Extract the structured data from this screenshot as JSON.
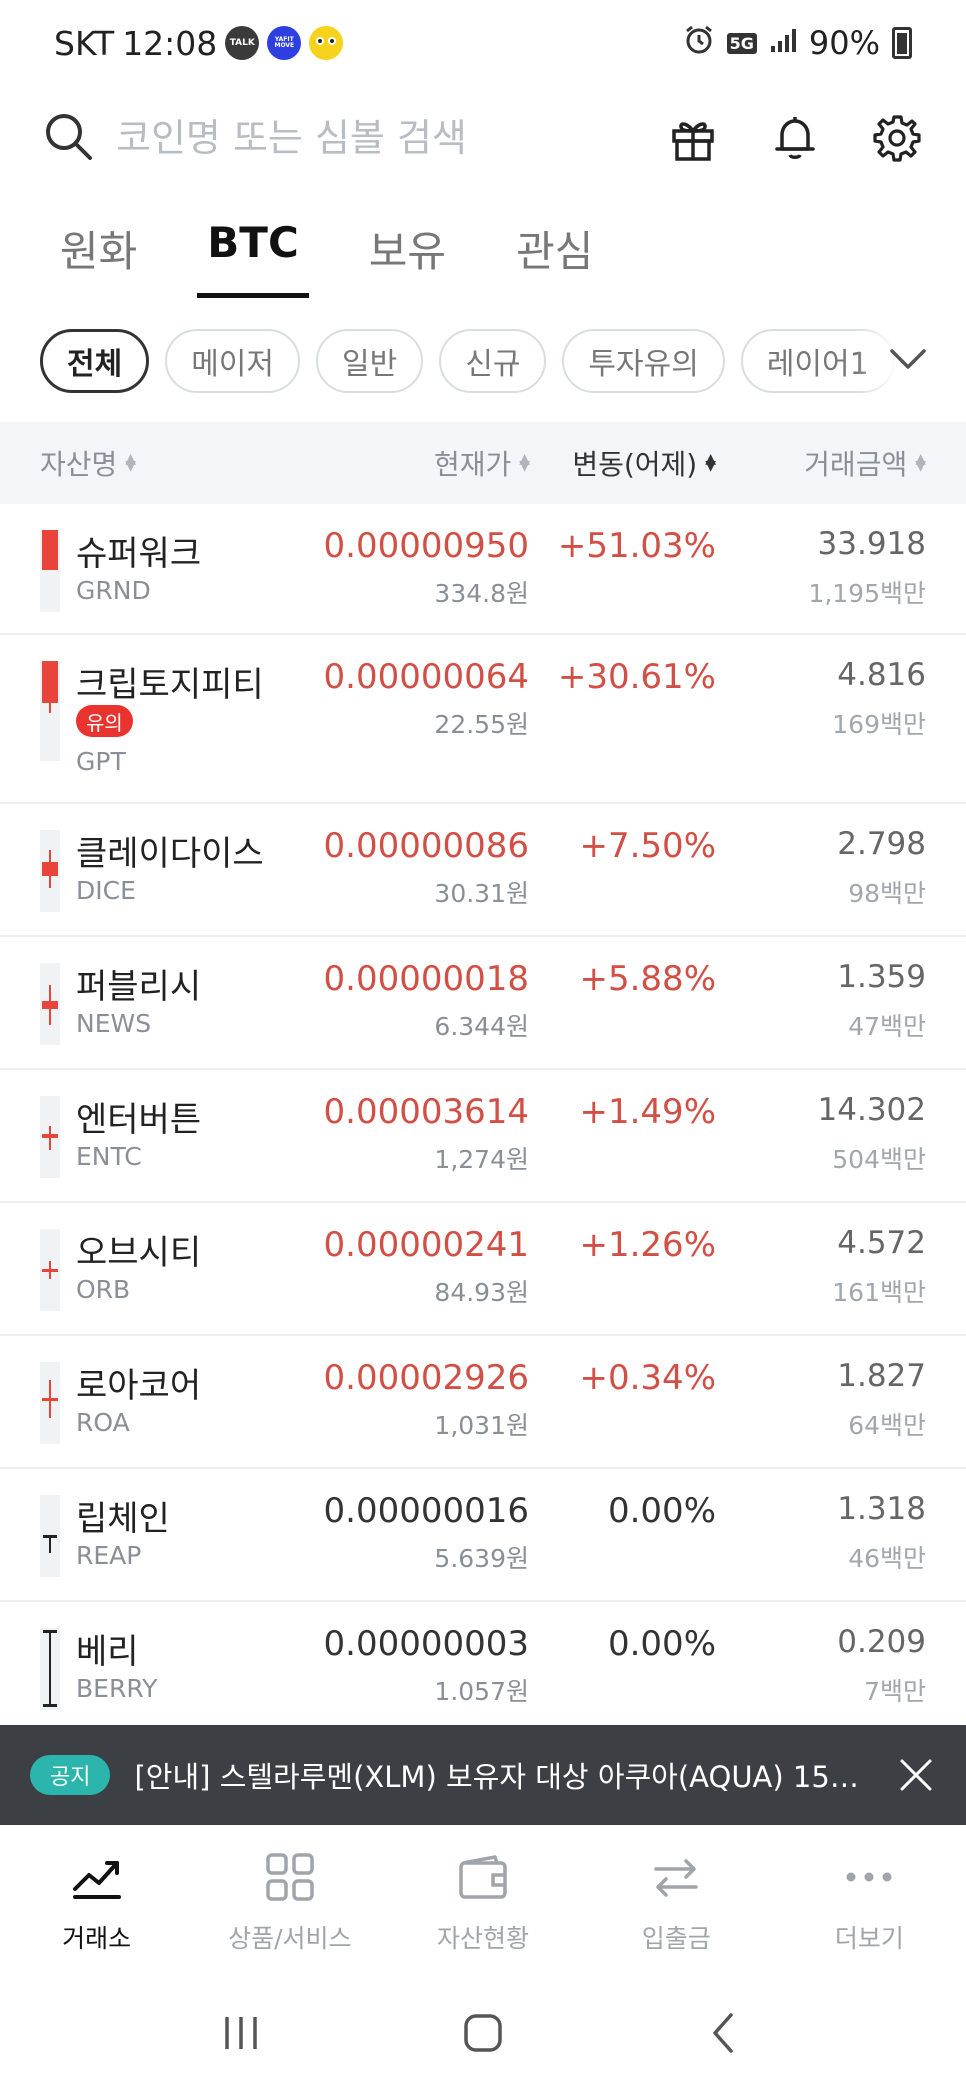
{
  "status_bar": {
    "carrier": "SKT",
    "time": "12:08",
    "talk_label": "TALK",
    "yafit_label": "YAFIT MOVE",
    "network": "5G",
    "battery": "90%"
  },
  "search": {
    "placeholder": "코인명 또는 심볼 검색"
  },
  "tabs": [
    {
      "label": "원화",
      "active": false
    },
    {
      "label": "BTC",
      "active": true
    },
    {
      "label": "보유",
      "active": false
    },
    {
      "label": "관심",
      "active": false
    }
  ],
  "filters": [
    {
      "label": "전체",
      "active": true
    },
    {
      "label": "메이저",
      "active": false
    },
    {
      "label": "일반",
      "active": false
    },
    {
      "label": "신규",
      "active": false
    },
    {
      "label": "투자유의",
      "active": false
    },
    {
      "label": "레이어1",
      "active": false
    }
  ],
  "columns": {
    "name": "자산명",
    "price": "현재가",
    "change": "변동(어제)",
    "volume": "거래금액"
  },
  "coins": [
    {
      "name": "슈퍼워크",
      "symbol": "GRND",
      "badge": "",
      "price": "0.00000950",
      "krw": "334.8원",
      "change": "+51.03%",
      "volume": "33.918",
      "volume_krw": "1,195백만",
      "direction": "up"
    },
    {
      "name": "크립토지피티",
      "symbol": "GPT",
      "badge": "유의",
      "price": "0.00000064",
      "krw": "22.55원",
      "change": "+30.61%",
      "volume": "4.816",
      "volume_krw": "169백만",
      "direction": "up"
    },
    {
      "name": "클레이다이스",
      "symbol": "DICE",
      "badge": "",
      "price": "0.00000086",
      "krw": "30.31원",
      "change": "+7.50%",
      "volume": "2.798",
      "volume_krw": "98백만",
      "direction": "up"
    },
    {
      "name": "퍼블리시",
      "symbol": "NEWS",
      "badge": "",
      "price": "0.00000018",
      "krw": "6.344원",
      "change": "+5.88%",
      "volume": "1.359",
      "volume_krw": "47백만",
      "direction": "up"
    },
    {
      "name": "엔터버튼",
      "symbol": "ENTC",
      "badge": "",
      "price": "0.00003614",
      "krw": "1,274원",
      "change": "+1.49%",
      "volume": "14.302",
      "volume_krw": "504백만",
      "direction": "up"
    },
    {
      "name": "오브시티",
      "symbol": "ORB",
      "badge": "",
      "price": "0.00000241",
      "krw": "84.93원",
      "change": "+1.26%",
      "volume": "4.572",
      "volume_krw": "161백만",
      "direction": "up"
    },
    {
      "name": "로아코어",
      "symbol": "ROA",
      "badge": "",
      "price": "0.00002926",
      "krw": "1,031원",
      "change": "+0.34%",
      "volume": "1.827",
      "volume_krw": "64백만",
      "direction": "up"
    },
    {
      "name": "립체인",
      "symbol": "REAP",
      "badge": "",
      "price": "0.00000016",
      "krw": "5.639원",
      "change": "0.00%",
      "volume": "1.318",
      "volume_krw": "46백만",
      "direction": "flat"
    },
    {
      "name": "베리",
      "symbol": "BERRY",
      "badge": "",
      "price": "0.00000003",
      "krw": "1.057원",
      "change": "0.00%",
      "volume": "0.209",
      "volume_krw": "7백만",
      "direction": "flat"
    }
  ],
  "notice": {
    "badge": "공지",
    "text": "[안내] 스텔라루멘(XLM) 보유자 대상 아쿠아(AQUA) 15…"
  },
  "bottom_nav": [
    {
      "label": "거래소",
      "icon": "chart-trend-icon",
      "active": true
    },
    {
      "label": "상품/서비스",
      "icon": "grid-icon",
      "active": false
    },
    {
      "label": "자산현황",
      "icon": "wallet-icon",
      "active": false
    },
    {
      "label": "입출금",
      "icon": "transfer-icon",
      "active": false
    },
    {
      "label": "더보기",
      "icon": "more-icon",
      "active": false
    }
  ],
  "colors": {
    "up": "#d24f45",
    "flat": "#333333",
    "notice_badge": "#2bb5ad",
    "warning_badge": "#e8332f"
  }
}
